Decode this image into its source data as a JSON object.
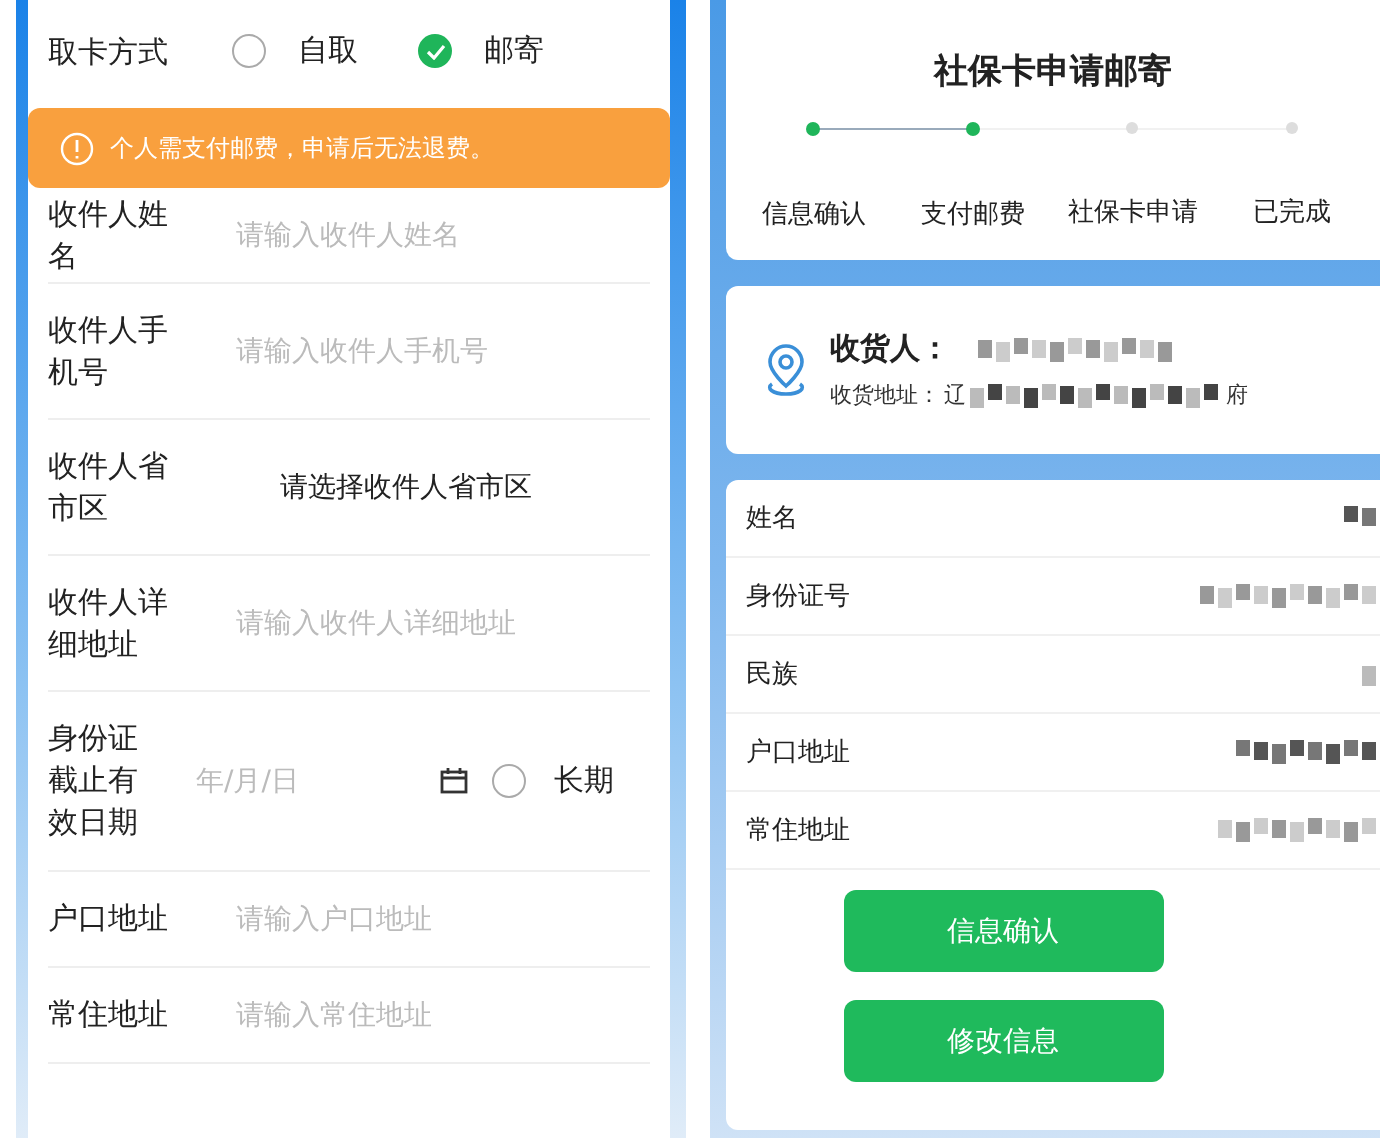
{
  "form": {
    "pickup": {
      "label": "取卡方式",
      "options": [
        {
          "label": "自取",
          "selected": false
        },
        {
          "label": "邮寄",
          "selected": true
        }
      ]
    },
    "notice": "个人需支付邮费，申请后无法退费。",
    "fields": [
      {
        "kind": "input",
        "label": "收件人姓名",
        "placeholder": "请输入收件人姓名"
      },
      {
        "kind": "input",
        "label": "收件人手机号",
        "placeholder": "请输入收件人手机号"
      },
      {
        "kind": "select",
        "label": "收件人省市区",
        "value": "请选择收件人省市区"
      },
      {
        "kind": "input",
        "label": "收件人详细地址",
        "placeholder": "请输入收件人详细地址"
      },
      {
        "kind": "date",
        "label": "身份证截止有效日期",
        "placeholder": "年/月/日",
        "option": {
          "label": "长期",
          "selected": false
        }
      },
      {
        "kind": "input",
        "label": "户口地址",
        "placeholder": "请输入户口地址"
      },
      {
        "kind": "input",
        "label": "常住地址",
        "placeholder": "请输入常住地址"
      }
    ]
  },
  "review": {
    "title": "社保卡申请邮寄",
    "steps": [
      {
        "label": "信息确认",
        "done": true
      },
      {
        "label": "支付邮费",
        "done": true
      },
      {
        "label": "社保卡申请",
        "done": false
      },
      {
        "label": "已完成",
        "done": false
      }
    ],
    "receiver": {
      "name_label": "收货人：",
      "address_label": "收货地址：",
      "address_start": "辽",
      "address_end": "府"
    },
    "info_rows": [
      {
        "label": "姓名"
      },
      {
        "label": "身份证号"
      },
      {
        "label": "民族"
      },
      {
        "label": "户口地址"
      },
      {
        "label": "常住地址"
      }
    ],
    "buttons": [
      "信息确认",
      "修改信息"
    ]
  }
}
